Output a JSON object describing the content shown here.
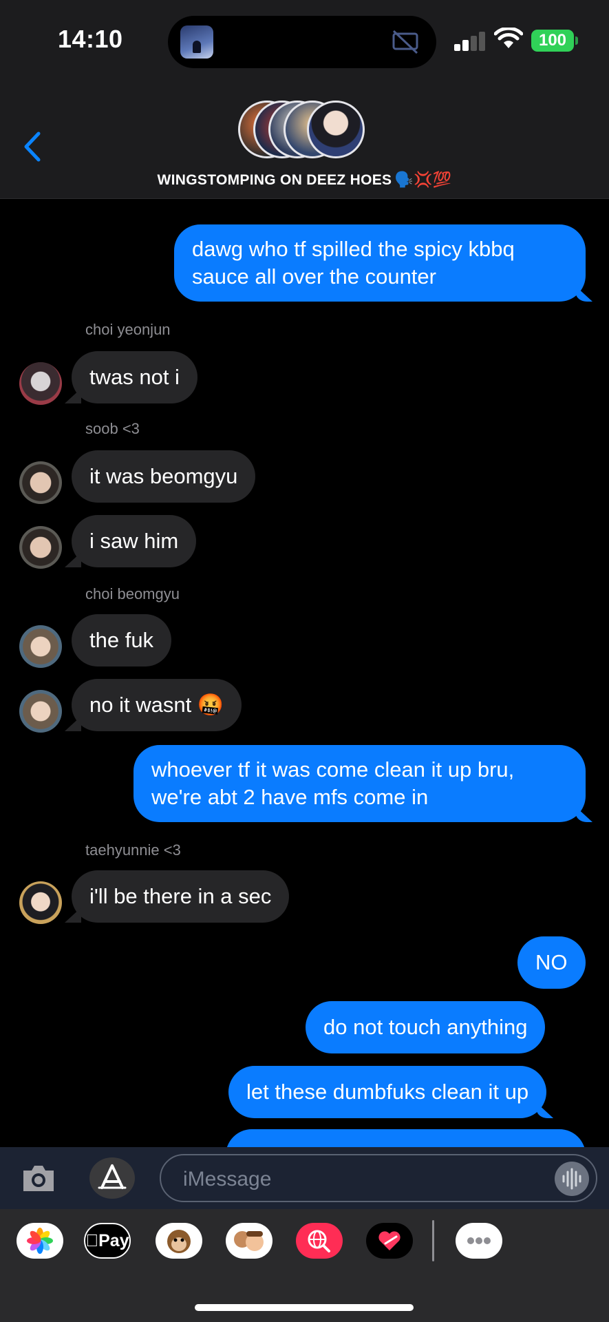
{
  "status_bar": {
    "time": "14:10",
    "battery": "100"
  },
  "header": {
    "group_name": "WINGSTOMPING ON DEEZ HOES",
    "group_emoji": "🗣️💢💯"
  },
  "messages": [
    {
      "kind": "sent",
      "lines": [
        "dawg who tf spilled the spicy kbbq",
        "sauce all over the counter"
      ]
    },
    {
      "kind": "sender",
      "text": "choi yeonjun"
    },
    {
      "kind": "received",
      "text": "twas not i"
    },
    {
      "kind": "sender",
      "text": "soob <3"
    },
    {
      "kind": "received",
      "text": "it was beomgyu"
    },
    {
      "kind": "received",
      "text": "i saw him"
    },
    {
      "kind": "sender",
      "text": "choi beomgyu"
    },
    {
      "kind": "received",
      "text": "the fuk"
    },
    {
      "kind": "received",
      "text": "no it wasnt 🤬"
    },
    {
      "kind": "sent",
      "lines": [
        "whoever tf it was come clean it up bru,",
        "we're abt 2 have mfs come in"
      ]
    },
    {
      "kind": "sender",
      "text": "taehyunnie <3"
    },
    {
      "kind": "received",
      "text": "i'll be there in a sec"
    },
    {
      "kind": "sent",
      "text": "NO"
    },
    {
      "kind": "sent",
      "text": "do not touch anything"
    },
    {
      "kind": "sent",
      "text": "let these dumbfuks clean it up"
    }
  ],
  "input": {
    "placeholder": "iMessage"
  },
  "apps": [
    "photos-app",
    "apple-pay-app",
    "memoji-stickers-app",
    "animoji-app",
    "image-search-app",
    "digital-touch-app",
    "more-apps"
  ],
  "apple_pay_label": "Pay",
  "colors": {
    "sent_bubble": "#0a7cff",
    "received_bubble": "#262628",
    "battery": "#30d158"
  }
}
